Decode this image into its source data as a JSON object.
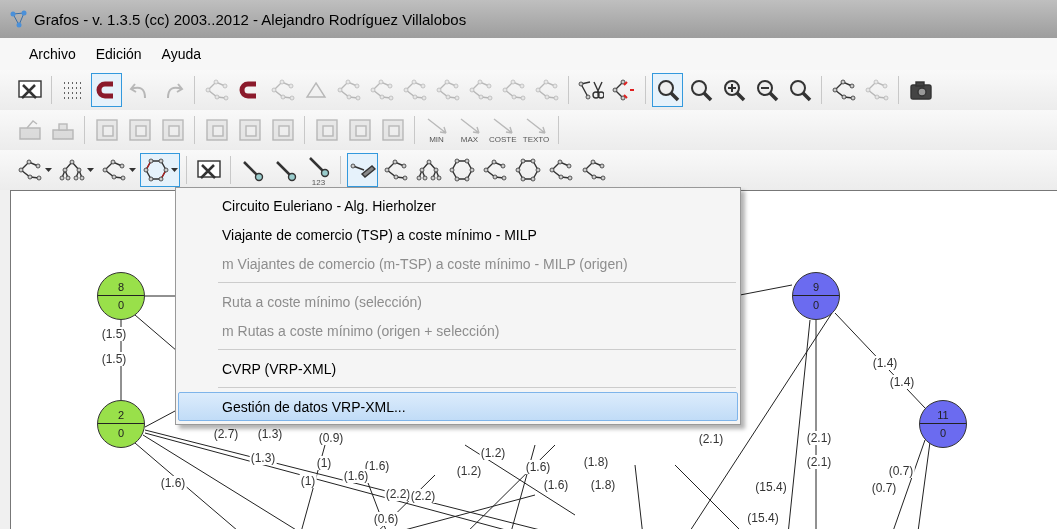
{
  "window": {
    "title": "Grafos - v. 1.3.5  (cc) 2003..2012 - Alejandro Rodríguez Villalobos"
  },
  "menu_bar": [
    {
      "label": "Archivo"
    },
    {
      "label": "Edición"
    },
    {
      "label": "Ayuda"
    }
  ],
  "toolbars": [
    {
      "items": [
        {
          "kind": "tools",
          "selected": false,
          "disabled": false
        },
        {
          "kind": "separator"
        },
        {
          "kind": "grid",
          "selected": false,
          "disabled": false
        },
        {
          "kind": "magnet",
          "selected": true,
          "disabled": false
        },
        {
          "kind": "undo",
          "selected": false,
          "disabled": true
        },
        {
          "kind": "redo",
          "selected": false,
          "disabled": true
        },
        {
          "kind": "separator"
        },
        {
          "kind": "graph",
          "selected": false,
          "disabled": true
        },
        {
          "kind": "magnet",
          "selected": false,
          "disabled": false
        },
        {
          "kind": "graph",
          "selected": false,
          "disabled": true
        },
        {
          "kind": "triangle",
          "selected": false,
          "disabled": true
        },
        {
          "kind": "graph",
          "selected": false,
          "disabled": true
        },
        {
          "kind": "graph",
          "selected": false,
          "disabled": true
        },
        {
          "kind": "graph",
          "selected": false,
          "disabled": true
        },
        {
          "kind": "graph",
          "selected": false,
          "disabled": true
        },
        {
          "kind": "graph",
          "selected": false,
          "disabled": true
        },
        {
          "kind": "graph",
          "selected": false,
          "disabled": true
        },
        {
          "kind": "graph",
          "selected": false,
          "disabled": true
        },
        {
          "kind": "separator"
        },
        {
          "kind": "scissors",
          "selected": false,
          "disabled": false
        },
        {
          "kind": "arrows",
          "selected": false,
          "disabled": false
        },
        {
          "kind": "separator"
        },
        {
          "kind": "zoom",
          "selected": true,
          "disabled": false
        },
        {
          "kind": "zoom",
          "selected": false,
          "disabled": false
        },
        {
          "kind": "zoom-in",
          "selected": false,
          "disabled": false
        },
        {
          "kind": "zoom-out",
          "selected": false,
          "disabled": false
        },
        {
          "kind": "zoom",
          "selected": false,
          "disabled": false
        },
        {
          "kind": "separator"
        },
        {
          "kind": "graph",
          "selected": false,
          "disabled": false
        },
        {
          "kind": "graph",
          "selected": false,
          "disabled": true
        },
        {
          "kind": "separator"
        },
        {
          "kind": "camera",
          "selected": false,
          "disabled": false
        }
      ]
    },
    {
      "items": [
        {
          "kind": "folder",
          "selected": false,
          "disabled": true
        },
        {
          "kind": "save",
          "selected": false,
          "disabled": true
        },
        {
          "kind": "separator"
        },
        {
          "kind": "panel",
          "selected": false,
          "disabled": true
        },
        {
          "kind": "panel",
          "selected": false,
          "disabled": true
        },
        {
          "kind": "panel",
          "selected": false,
          "disabled": true
        },
        {
          "kind": "separator"
        },
        {
          "kind": "panel",
          "selected": false,
          "disabled": true
        },
        {
          "kind": "panel",
          "selected": false,
          "disabled": true
        },
        {
          "kind": "panel",
          "selected": false,
          "disabled": true
        },
        {
          "kind": "separator"
        },
        {
          "kind": "panel",
          "selected": false,
          "disabled": true
        },
        {
          "kind": "panel",
          "selected": false,
          "disabled": true
        },
        {
          "kind": "panel",
          "selected": false,
          "disabled": true
        },
        {
          "kind": "separator"
        },
        {
          "kind": "arrow",
          "caption": "MIN",
          "selected": false,
          "disabled": true
        },
        {
          "kind": "arrow",
          "caption": "MAX",
          "selected": false,
          "disabled": true
        },
        {
          "kind": "arrow",
          "caption": "COSTE",
          "selected": false,
          "disabled": true
        },
        {
          "kind": "arrow",
          "caption": "TEXTO",
          "selected": false,
          "disabled": true
        },
        {
          "kind": "separator"
        }
      ]
    },
    {
      "items": [
        {
          "kind": "graph-menu",
          "selected": false,
          "disabled": false
        },
        {
          "kind": "tree-menu",
          "selected": false,
          "disabled": false
        },
        {
          "kind": "graph-menu",
          "selected": false,
          "disabled": false
        },
        {
          "kind": "cycle-menu",
          "selected": true,
          "disabled": false
        },
        {
          "kind": "separator"
        },
        {
          "kind": "tools",
          "selected": false,
          "disabled": false
        },
        {
          "kind": "separator"
        },
        {
          "kind": "edge",
          "selected": false,
          "disabled": false
        },
        {
          "kind": "edge",
          "selected": false,
          "disabled": false
        },
        {
          "kind": "edge",
          "caption": "123",
          "selected": false,
          "disabled": false
        },
        {
          "kind": "separator"
        },
        {
          "kind": "pencil",
          "selected": true,
          "disabled": false
        },
        {
          "kind": "graph",
          "selected": false,
          "disabled": false
        },
        {
          "kind": "tree",
          "selected": false,
          "disabled": false
        },
        {
          "kind": "cycle",
          "selected": false,
          "disabled": false
        },
        {
          "kind": "graph",
          "selected": false,
          "disabled": false
        },
        {
          "kind": "cycle",
          "selected": false,
          "disabled": false
        },
        {
          "kind": "graph",
          "selected": false,
          "disabled": false
        },
        {
          "kind": "graph",
          "selected": false,
          "disabled": false
        }
      ]
    }
  ],
  "dropdown_menu": [
    {
      "kind": "item",
      "label": "Circuito Euleriano - Alg. Hierholzer",
      "disabled": false,
      "selected": false
    },
    {
      "kind": "item",
      "label": "Viajante de comercio (TSP) a coste mínimo - MILP",
      "disabled": false,
      "selected": false
    },
    {
      "kind": "item",
      "label": "m Viajantes de comercio (m-TSP) a coste mínimo - MILP (origen)",
      "disabled": true,
      "selected": false
    },
    {
      "kind": "separator"
    },
    {
      "kind": "item",
      "label": "Ruta a coste mínimo (selección)",
      "disabled": true,
      "selected": false
    },
    {
      "kind": "item",
      "label": "m Rutas a coste mínimo (origen + selección)",
      "disabled": true,
      "selected": false
    },
    {
      "kind": "separator"
    },
    {
      "kind": "item",
      "label": "CVRP (VRP-XML)",
      "disabled": false,
      "selected": false
    },
    {
      "kind": "separator"
    },
    {
      "kind": "item",
      "label": "Gestión de datos VRP-XML...",
      "disabled": false,
      "selected": true
    }
  ],
  "graph": {
    "nodes": [
      {
        "label": "8",
        "value": "0",
        "color": "#99e04a"
      },
      {
        "label": "2",
        "value": "0",
        "color": "#99e04a"
      },
      {
        "label": "9",
        "value": "0",
        "color": "#6b6bf0"
      },
      {
        "label": "11",
        "value": "0",
        "color": "#6b6bf0"
      }
    ],
    "edge_labels": [
      "(1.5)",
      "(1.5)",
      "(2.7)",
      "(1.3)",
      "(0.9)",
      "(1.3)",
      "(1)",
      "(1.6)",
      "(1.6)",
      "(1)",
      "(1.6)",
      "(2.2)",
      "(2.2)",
      "(0.6)",
      "(1.2)",
      "(1.2)",
      "(1.6)",
      "(1.6)",
      "(1.8)",
      "(1.8)",
      "(2.1)",
      "(15.4)",
      "(15.4)",
      "(2.1)",
      "(2.1)",
      "(1.4)",
      "(1.4)",
      "(0.7)",
      "(0.7)"
    ]
  }
}
